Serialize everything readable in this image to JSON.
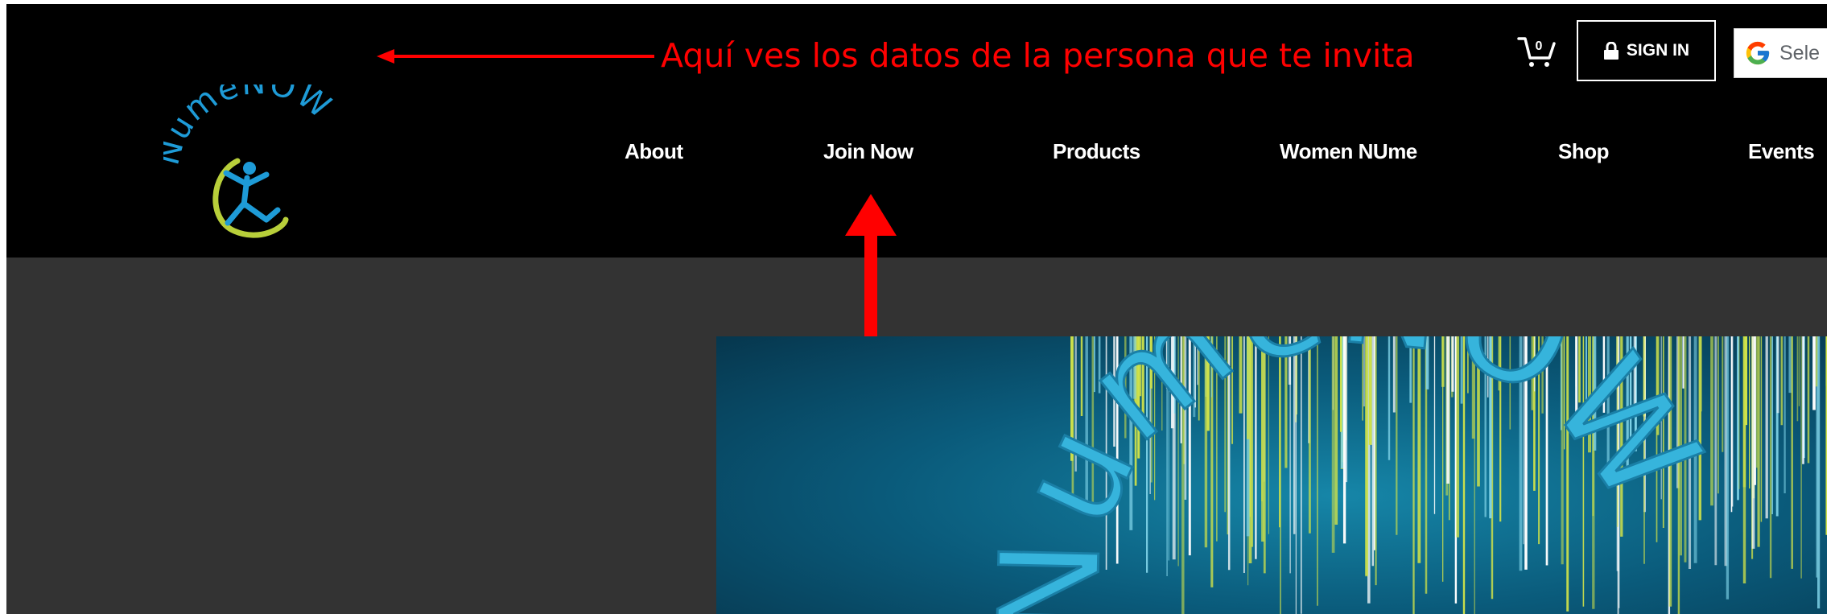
{
  "annotation": {
    "text": "Aquí ves los datos de la persona que te invita",
    "color": "#ff0000"
  },
  "brand": {
    "logo_text": "NumeNOW",
    "hero_text": "NumeNOW"
  },
  "header": {
    "cart_count": "0",
    "signin_label": "SIGN IN",
    "translate_label": "Sele"
  },
  "nav": {
    "items": [
      {
        "label": "About"
      },
      {
        "label": "Join Now"
      },
      {
        "label": "Products"
      },
      {
        "label": "Women NUme"
      },
      {
        "label": "Shop"
      },
      {
        "label": "Events"
      }
    ]
  },
  "colors": {
    "header_bg": "#000000",
    "page_bg": "#333333",
    "logo_blue": "#1e9bd7",
    "logo_green": "#b8cf3a",
    "hero_teal": "#0a5a7a",
    "hero_lime": "#cfe24a"
  },
  "icons": {
    "cart": "cart-icon",
    "lock": "lock-icon",
    "google": "google-icon",
    "arrow_left": "arrow-left-icon",
    "arrow_up": "arrow-up-icon"
  }
}
